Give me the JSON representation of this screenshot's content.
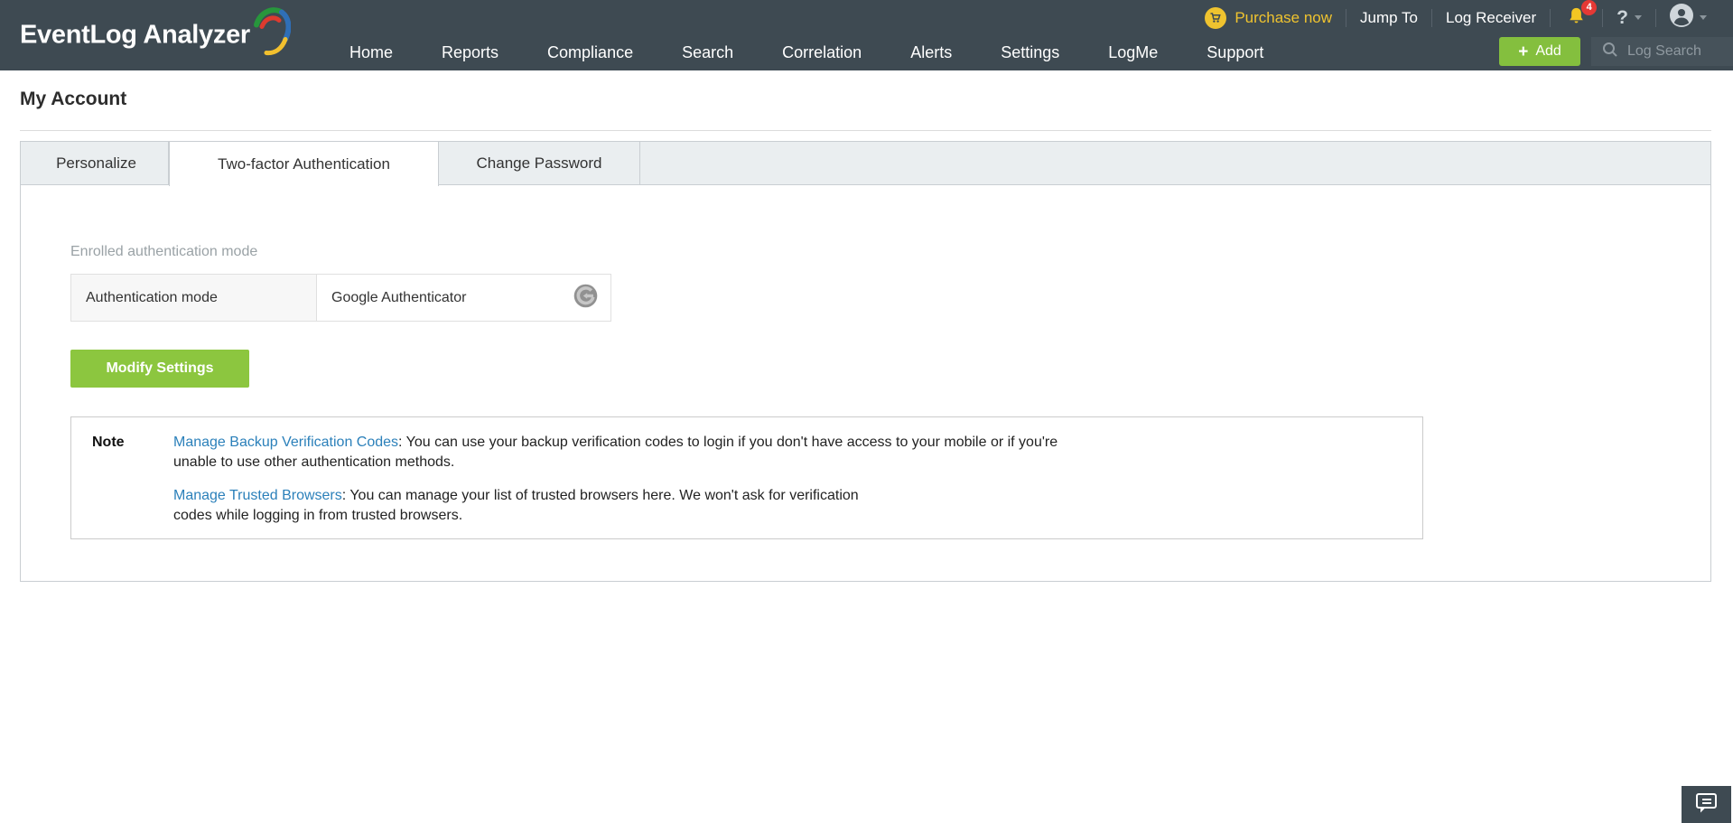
{
  "header": {
    "logo_text": "EventLog Analyzer",
    "topbar": {
      "purchase_now": "Purchase now",
      "jump_to": "Jump To",
      "log_receiver": "Log Receiver",
      "notification_count": "4",
      "help_label": "?"
    },
    "nav_items": [
      "Home",
      "Reports",
      "Compliance",
      "Search",
      "Correlation",
      "Alerts",
      "Settings",
      "LogMe",
      "Support"
    ],
    "add_plus": "+",
    "add_label": "Add",
    "log_search_label": "Log Search"
  },
  "page": {
    "title": "My Account",
    "tabs": {
      "personalize": "Personalize",
      "two_factor": "Two-factor Authentication",
      "change_password": "Change Password"
    },
    "section_label": "Enrolled authentication mode",
    "auth_table": {
      "label": "Authentication mode",
      "value": "Google Authenticator",
      "icon": "google-authenticator-icon"
    },
    "modify_button_label": "Modify Settings",
    "note": {
      "label": "Note",
      "items": [
        {
          "link": "Manage Backup Verification Codes",
          "text_line1": ": You can use your backup verification codes to login if you don't have access to your mobile or if you're",
          "text_line2": "unable to use other authentication methods."
        },
        {
          "link": "Manage Trusted Browsers",
          "text_line1": ": You can manage your list of trusted browsers here. We won't ask for verification",
          "text_line2": "codes while logging in from trusted browsers."
        }
      ]
    }
  },
  "colors": {
    "header_bg": "#3e4a52",
    "accent_gold": "#efc32f",
    "modify_green": "#8cc63f",
    "add_green": "#84bf3e",
    "link_blue": "#2b80ba",
    "badge_red": "#e53935",
    "tabbar_bg": "#eaeef0"
  }
}
